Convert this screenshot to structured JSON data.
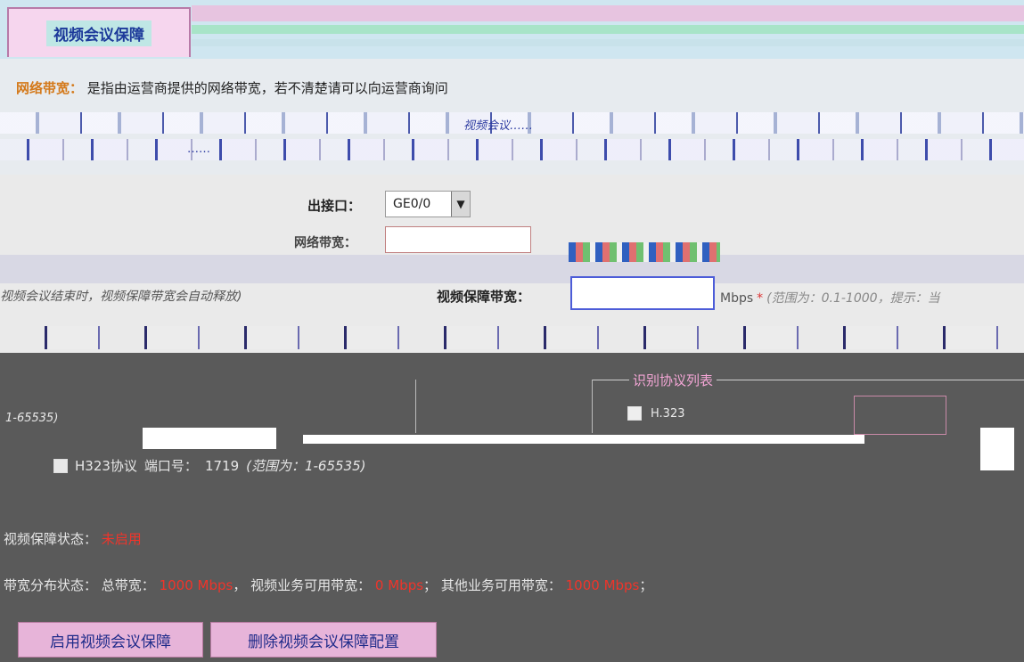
{
  "tab": {
    "active_label": "视频会议保障"
  },
  "info": {
    "network_bw_label": "网络带宽：",
    "network_bw_desc": "是指由运营商提供的网络带宽，若不清楚请可以向运营商询问",
    "smear_line1": "视频会议……",
    "smear_line2": "……"
  },
  "form": {
    "interface_label": "出接口：",
    "interface_value": "GE0/0",
    "network_bw_label": "网络带宽：",
    "auto_release_note": "视频会议结束时，视频保障带宽会自动释放)",
    "video_bw_label": "视频保障带宽：",
    "video_bw_unit": "Mbps",
    "required_mark": "*",
    "video_bw_hint": "(范围为：0.1-1000，提示：当"
  },
  "protocol": {
    "title": "识别协议列表",
    "left_range": "1-65535)",
    "row1_label": "H.323",
    "row2_label": "H323协议",
    "row2_port_label": "端口号：",
    "row2_port_value": "1719",
    "row2_range": "(范围为：1-65535)"
  },
  "status": {
    "video_status_label": "视频保障状态：",
    "video_status_value": "未启用",
    "bw_status_label": "带宽分布状态：",
    "total_bw_label": "总带宽：",
    "total_bw_value": "1000 Mbps",
    "video_avail_label": "视频业务可用带宽：",
    "video_avail_value": "0 Mbps",
    "other_avail_label": "其他业务可用带宽：",
    "other_avail_value": "1000 Mbps"
  },
  "buttons": {
    "enable": "启用视频会议保障",
    "delete": "删除视频会议保障配置"
  }
}
